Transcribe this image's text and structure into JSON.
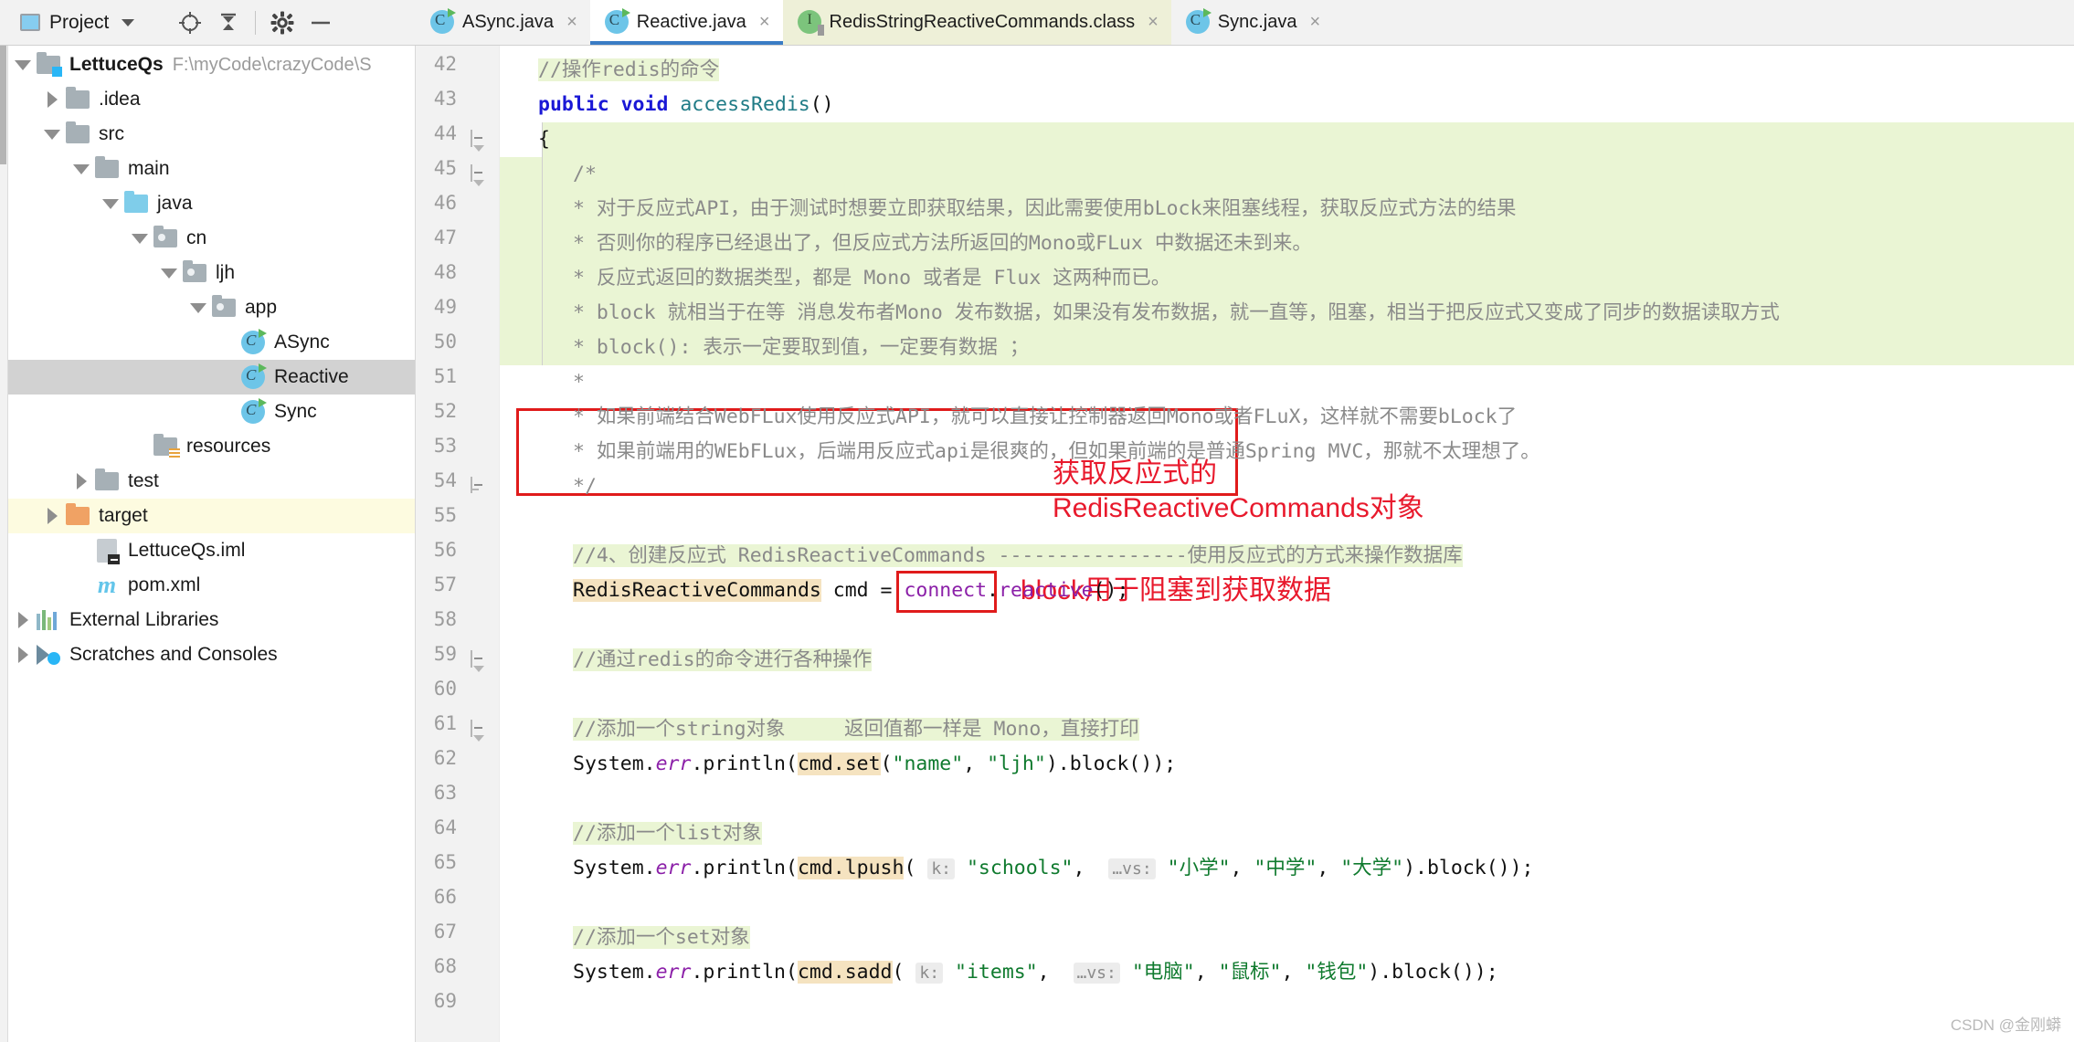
{
  "toolwindow": {
    "title": "Project",
    "icons": [
      "project-icon",
      "chevron-down-icon",
      "locate-icon",
      "collapse-all-icon",
      "gear-icon",
      "minimize-icon"
    ]
  },
  "tabs": [
    {
      "label": "ASync.java",
      "icon": "java-class-icon",
      "state": "inactive",
      "close": "×"
    },
    {
      "label": "Reactive.java",
      "icon": "java-class-icon",
      "state": "active",
      "close": "×"
    },
    {
      "label": "RedisStringReactiveCommands.class",
      "icon": "java-interface-icon",
      "state": "tinted",
      "close": "×"
    },
    {
      "label": "Sync.java",
      "icon": "java-class-icon",
      "state": "inactive",
      "close": "×"
    }
  ],
  "sidebar": {
    "items": [
      {
        "label": "LettuceQs",
        "path": "F:\\myCode\\crazyCode\\S",
        "indent": 0,
        "arrow": "down",
        "icon": "module-folder-icon",
        "bold": true,
        "highlight": "none"
      },
      {
        "label": ".idea",
        "path": "",
        "indent": 1,
        "arrow": "right",
        "icon": "folder-icon",
        "bold": false,
        "highlight": "none"
      },
      {
        "label": "src",
        "path": "",
        "indent": 1,
        "arrow": "down",
        "icon": "folder-icon",
        "bold": false,
        "highlight": "none"
      },
      {
        "label": "main",
        "path": "",
        "indent": 2,
        "arrow": "down",
        "icon": "folder-icon",
        "bold": false,
        "highlight": "none"
      },
      {
        "label": "java",
        "path": "",
        "indent": 3,
        "arrow": "down",
        "icon": "source-folder-icon",
        "bold": false,
        "highlight": "none"
      },
      {
        "label": "cn",
        "path": "",
        "indent": 4,
        "arrow": "down",
        "icon": "package-icon",
        "bold": false,
        "highlight": "none"
      },
      {
        "label": "ljh",
        "path": "",
        "indent": 5,
        "arrow": "down",
        "icon": "package-icon",
        "bold": false,
        "highlight": "none"
      },
      {
        "label": "app",
        "path": "",
        "indent": 6,
        "arrow": "down",
        "icon": "package-icon",
        "bold": false,
        "highlight": "none"
      },
      {
        "label": "ASync",
        "path": "",
        "indent": 7,
        "arrow": "none",
        "icon": "java-class-icon",
        "bold": false,
        "highlight": "none"
      },
      {
        "label": "Reactive",
        "path": "",
        "indent": 7,
        "arrow": "none",
        "icon": "java-class-icon",
        "bold": false,
        "highlight": "gray"
      },
      {
        "label": "Sync",
        "path": "",
        "indent": 7,
        "arrow": "none",
        "icon": "java-class-icon",
        "bold": false,
        "highlight": "none"
      },
      {
        "label": "resources",
        "path": "",
        "indent": 4,
        "arrow": "none",
        "icon": "resource-folder-icon",
        "bold": false,
        "highlight": "none"
      },
      {
        "label": "test",
        "path": "",
        "indent": 2,
        "arrow": "right",
        "icon": "folder-icon",
        "bold": false,
        "highlight": "none"
      },
      {
        "label": "target",
        "path": "",
        "indent": 1,
        "arrow": "right",
        "icon": "excluded-folder-icon",
        "bold": false,
        "highlight": "yellow"
      },
      {
        "label": "LettuceQs.iml",
        "path": "",
        "indent": 2,
        "arrow": "none",
        "icon": "iml-file-icon",
        "bold": false,
        "highlight": "none"
      },
      {
        "label": "pom.xml",
        "path": "",
        "indent": 2,
        "arrow": "none",
        "icon": "maven-file-icon",
        "bold": false,
        "highlight": "none"
      },
      {
        "label": "External Libraries",
        "path": "",
        "indent": 0,
        "arrow": "right",
        "icon": "libraries-icon",
        "bold": false,
        "highlight": "none"
      },
      {
        "label": "Scratches and Consoles",
        "path": "",
        "indent": 0,
        "arrow": "right",
        "icon": "scratches-icon",
        "bold": false,
        "highlight": "none"
      }
    ]
  },
  "editor": {
    "first_line": 42,
    "lines": [
      {
        "n": 42,
        "fold": "none",
        "tokens": [
          {
            "t": "//操作redis的命令",
            "c": "c-cmt",
            "bg": "green"
          }
        ],
        "indent": 0
      },
      {
        "n": 43,
        "fold": "none",
        "tokens": [
          {
            "t": "public void ",
            "c": "c-kw"
          },
          {
            "t": "accessRedis",
            "c": "c-fn"
          },
          {
            "t": "()",
            "c": "c-plain"
          }
        ],
        "indent": 0
      },
      {
        "n": 44,
        "fold": "tip",
        "tokens": [
          {
            "t": "{",
            "c": "c-plain"
          }
        ],
        "indent": 0
      },
      {
        "n": 45,
        "fold": "tip",
        "tokens": [
          {
            "t": "/*",
            "c": "c-cmt",
            "bg": "green"
          }
        ],
        "indent": 1
      },
      {
        "n": 46,
        "fold": "none",
        "tokens": [
          {
            "t": "* 对于反应式API，由于测试时想要立即获取结果，因此需要使用bLock来阻塞线程，获取反应式方法的结果",
            "c": "c-cmt"
          }
        ],
        "indent": 1
      },
      {
        "n": 47,
        "fold": "none",
        "tokens": [
          {
            "t": "* 否则你的程序已经退出了，但反应式方法所返回的Mono或FLux 中数据还未到来。",
            "c": "c-cmt"
          }
        ],
        "indent": 1
      },
      {
        "n": 48,
        "fold": "none",
        "tokens": [
          {
            "t": "* 反应式返回的数据类型，都是 Mono 或者是 Flux 这两种而已。",
            "c": "c-cmt"
          }
        ],
        "indent": 1
      },
      {
        "n": 49,
        "fold": "none",
        "tokens": [
          {
            "t": "* block 就相当于在等 消息发布者Mono 发布数据，如果没有发布数据，就一直等，阻塞，相当于把反应式又变成了同步的数据读取方式",
            "c": "c-cmt"
          }
        ],
        "indent": 1
      },
      {
        "n": 50,
        "fold": "none",
        "tokens": [
          {
            "t": "* block(): 表示一定要取到值，一定要有数据 ；",
            "c": "c-cmt"
          }
        ],
        "indent": 1
      },
      {
        "n": 51,
        "fold": "none",
        "tokens": [
          {
            "t": "*",
            "c": "c-cmt"
          }
        ],
        "indent": 1
      },
      {
        "n": 52,
        "fold": "none",
        "tokens": [
          {
            "t": "* 如果前端结合WebFLux使用反应式API，就可以直接让控制器返回Mono或者FLuX，这样就不需要bLock了",
            "c": "c-cmt"
          }
        ],
        "indent": 1
      },
      {
        "n": 53,
        "fold": "none",
        "tokens": [
          {
            "t": "* 如果前端用的WEbFLux，后端用反应式api是很爽的，但如果前端的是普通Spring MVC，那就不太理想了。",
            "c": "c-cmt"
          }
        ],
        "indent": 1
      },
      {
        "n": 54,
        "fold": "end",
        "tokens": [
          {
            "t": "*/",
            "c": "c-cmt"
          }
        ],
        "indent": 1
      },
      {
        "n": 55,
        "fold": "none",
        "tokens": [],
        "indent": 1
      },
      {
        "n": 56,
        "fold": "none",
        "tokens": [
          {
            "t": "//4、创建反应式 RedisReactiveCommands ----------------使用反应式的方式来操作数据库",
            "c": "c-cmt",
            "bg": "green"
          }
        ],
        "indent": 1
      },
      {
        "n": 57,
        "fold": "none",
        "tokens": [
          {
            "t": "RedisReactiveCommands",
            "c": "c-plain",
            "hl": "orange"
          },
          {
            "t": " cmd = ",
            "c": "c-plain"
          },
          {
            "t": "connect",
            "c": "c-meth"
          },
          {
            "t": ".",
            "c": "c-plain"
          },
          {
            "t": "reactive",
            "c": "c-meth"
          },
          {
            "t": "();",
            "c": "c-plain"
          }
        ],
        "indent": 1
      },
      {
        "n": 58,
        "fold": "none",
        "tokens": [],
        "indent": 1
      },
      {
        "n": 59,
        "fold": "tip",
        "tokens": [
          {
            "t": "//通过redis的命令进行各种操作",
            "c": "c-cmt",
            "bg": "green"
          }
        ],
        "indent": 1
      },
      {
        "n": 60,
        "fold": "none",
        "tokens": [],
        "indent": 1
      },
      {
        "n": 61,
        "fold": "tip",
        "tokens": [
          {
            "t": "//添加一个string对象　　　返回值都一样是 Mono，直接打印",
            "c": "c-cmt",
            "bg": "green"
          }
        ],
        "indent": 1
      },
      {
        "n": 62,
        "fold": "none",
        "tokens": [
          {
            "t": "System.",
            "c": "c-plain"
          },
          {
            "t": "err",
            "c": "c-fld"
          },
          {
            "t": ".println(",
            "c": "c-plain"
          },
          {
            "t": "cmd.set",
            "c": "c-plain",
            "hl": "orange"
          },
          {
            "t": "(",
            "c": "c-plain"
          },
          {
            "t": "\"name\"",
            "c": "c-str"
          },
          {
            "t": ", ",
            "c": "c-plain"
          },
          {
            "t": "\"ljh\"",
            "c": "c-str"
          },
          {
            "t": ")",
            "c": "c-plain"
          },
          {
            "t": ".block());",
            "c": "c-plain"
          }
        ],
        "indent": 1
      },
      {
        "n": 63,
        "fold": "none",
        "tokens": [],
        "indent": 1
      },
      {
        "n": 64,
        "fold": "none",
        "tokens": [
          {
            "t": "//添加一个list对象",
            "c": "c-cmt",
            "bg": "green"
          }
        ],
        "indent": 1
      },
      {
        "n": 65,
        "fold": "none",
        "tokens": [
          {
            "t": "System.",
            "c": "c-plain"
          },
          {
            "t": "err",
            "c": "c-fld"
          },
          {
            "t": ".println(",
            "c": "c-plain"
          },
          {
            "t": "cmd.lpush",
            "c": "c-plain",
            "hl": "orange"
          },
          {
            "t": "( ",
            "c": "c-plain"
          },
          {
            "t": "k:",
            "c": "hint"
          },
          {
            "t": " ",
            "c": "c-plain"
          },
          {
            "t": "\"schools\"",
            "c": "c-str"
          },
          {
            "t": ",  ",
            "c": "c-plain"
          },
          {
            "t": "…vs:",
            "c": "hint"
          },
          {
            "t": " ",
            "c": "c-plain"
          },
          {
            "t": "\"小学\"",
            "c": "c-str"
          },
          {
            "t": ", ",
            "c": "c-plain"
          },
          {
            "t": "\"中学\"",
            "c": "c-str"
          },
          {
            "t": ", ",
            "c": "c-plain"
          },
          {
            "t": "\"大学\"",
            "c": "c-str"
          },
          {
            "t": ").block());",
            "c": "c-plain"
          }
        ],
        "indent": 1
      },
      {
        "n": 66,
        "fold": "none",
        "tokens": [],
        "indent": 1
      },
      {
        "n": 67,
        "fold": "none",
        "tokens": [
          {
            "t": "//添加一个set对象",
            "c": "c-cmt",
            "bg": "green"
          }
        ],
        "indent": 1
      },
      {
        "n": 68,
        "fold": "none",
        "tokens": [
          {
            "t": "System.",
            "c": "c-plain"
          },
          {
            "t": "err",
            "c": "c-fld"
          },
          {
            "t": ".println(",
            "c": "c-plain"
          },
          {
            "t": "cmd.sadd",
            "c": "c-plain",
            "hl": "orange"
          },
          {
            "t": "( ",
            "c": "c-plain"
          },
          {
            "t": "k:",
            "c": "hint"
          },
          {
            "t": " ",
            "c": "c-plain"
          },
          {
            "t": "\"items\"",
            "c": "c-str"
          },
          {
            "t": ",  ",
            "c": "c-plain"
          },
          {
            "t": "…vs:",
            "c": "hint"
          },
          {
            "t": " ",
            "c": "c-plain"
          },
          {
            "t": "\"电脑\"",
            "c": "c-str"
          },
          {
            "t": ", ",
            "c": "c-plain"
          },
          {
            "t": "\"鼠标\"",
            "c": "c-str"
          },
          {
            "t": ", ",
            "c": "c-plain"
          },
          {
            "t": "\"钱包\"",
            "c": "c-str"
          },
          {
            "t": ").block());",
            "c": "c-plain"
          }
        ],
        "indent": 1
      },
      {
        "n": 69,
        "fold": "none",
        "tokens": [],
        "indent": 1
      }
    ]
  },
  "annotations": [
    {
      "name": "annotation-reactive-commands",
      "text": "获取反应式的\nRedisReactiveCommands对象",
      "color": "#e8192c"
    },
    {
      "name": "annotation-block",
      "text": "block用于阻塞到获取数据",
      "color": "#e8192c"
    }
  ],
  "watermark": "CSDN @金刚蟒",
  "colors": {
    "accent": "#3a7cc4",
    "comment_bg": "#eaf5d4",
    "highlight_orange": "#f5e3c0",
    "annotation_red": "#e8192c",
    "selection_gray": "#d2d2d2",
    "selection_yellow": "#fdfbe0"
  }
}
